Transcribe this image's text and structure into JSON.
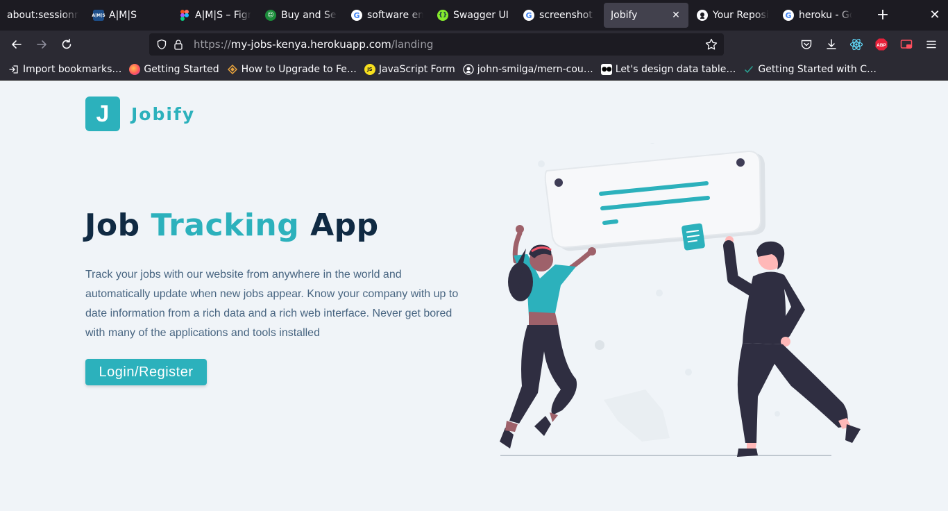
{
  "browser": {
    "tabs": [
      {
        "title": "about:sessionrestore",
        "favicon": "none",
        "active": false
      },
      {
        "title": "A|M|S",
        "favicon": "ams-icon",
        "active": false
      },
      {
        "title": "A|M|S – Figma",
        "favicon": "figma-icon",
        "active": false
      },
      {
        "title": "Buy and Sell",
        "favicon": "smiley-icon",
        "active": false
      },
      {
        "title": "software engineer",
        "favicon": "google-icon",
        "active": false
      },
      {
        "title": "Swagger UI",
        "favicon": "swagger-icon",
        "active": false
      },
      {
        "title": "screenshot of",
        "favicon": "google-icon",
        "active": false
      },
      {
        "title": "Jobify",
        "favicon": "none",
        "active": true
      },
      {
        "title": "Your Repositories",
        "favicon": "github-icon",
        "active": false
      },
      {
        "title": "heroku - Google",
        "favicon": "google-icon",
        "active": false
      }
    ],
    "url": {
      "scheme": "https://",
      "host": "my-jobs-kenya.herokuapp.com",
      "path": "/landing"
    },
    "bookmarks": [
      {
        "label": "Import bookmarks…",
        "icon": "import-icon"
      },
      {
        "label": "Getting Started",
        "icon": "firefox-icon"
      },
      {
        "label": "How to Upgrade to Fe…",
        "icon": "diamond-icon"
      },
      {
        "label": "JavaScript Form",
        "icon": "js-icon"
      },
      {
        "label": "john-smilga/mern-cou…",
        "icon": "github-icon"
      },
      {
        "label": "Let's design data table…",
        "icon": "medium-icon"
      },
      {
        "label": "Getting Started with C…",
        "icon": "check-icon"
      }
    ],
    "colors": {
      "tabbar": "#1c1b22",
      "toolbar": "#2b2a33",
      "active_tab": "#42414d"
    }
  },
  "page": {
    "logo": {
      "letter": "J",
      "text": "Jobify"
    },
    "title": {
      "part1": "Job",
      "accent": "Tracking",
      "part2": "App"
    },
    "description": "Track your jobs with our website from anywhere in the world and automatically update when new jobs appear. Know your company with up to date information from a rich data and a rich web interface. Never get bored with many of the applications and tools installed",
    "cta_label": "Login/Register",
    "colors": {
      "primary": "#2cb1bc",
      "heading": "#102a43",
      "text": "#486581",
      "background": "#f0f4f8"
    }
  }
}
